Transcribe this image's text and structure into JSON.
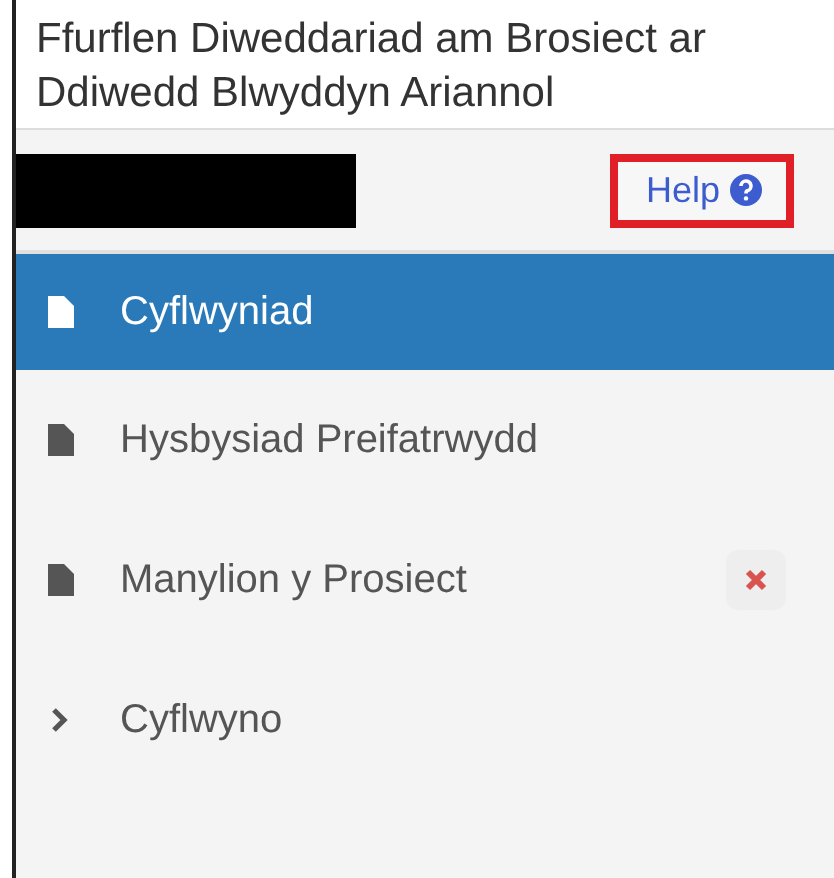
{
  "title": "Ffurflen Diweddariad am Brosiect ar Ddiwedd Blwyddyn Ariannol",
  "toolbar": {
    "redacted": true,
    "help_link": "Help"
  },
  "nav": [
    {
      "kind": "page",
      "label": "Cyflwyniad",
      "selected": true,
      "error": false
    },
    {
      "kind": "page",
      "label": "Hysbysiad Preifatrwydd",
      "selected": false,
      "error": false
    },
    {
      "kind": "page",
      "label": "Manylion y Prosiect",
      "selected": false,
      "error": true
    },
    {
      "kind": "section",
      "label": "Cyflwyno",
      "selected": false,
      "error": false
    }
  ]
}
